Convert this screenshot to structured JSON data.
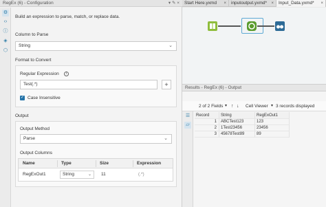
{
  "config": {
    "title": "RegEx (6) - Configuration",
    "title_icons": "▾ ✎ ×",
    "description": "Build an expression to parse, match, or replace data.",
    "column_to_parse": {
      "label": "Column to Parse",
      "value": "String"
    },
    "format_to_convert": {
      "label": "Format to Convert",
      "regex_label": "Regular Expression",
      "regex_value": "Test(.*)",
      "plus_label": "+",
      "case_insensitive_label": "Case Insensitive",
      "case_insensitive_checked": true
    },
    "output": {
      "label": "Output",
      "method_label": "Output Method",
      "method_value": "Parse",
      "columns_label": "Output Columns",
      "columns_headers": [
        "Name",
        "Type",
        "Size",
        "Expression"
      ],
      "columns_rows": [
        {
          "name": "RegExOut1",
          "type": "String",
          "size": "11",
          "expression": "(.*)"
        }
      ]
    }
  },
  "tabs": [
    {
      "label": "Start Here.yxmd"
    },
    {
      "label": "inputoutput.yxmd*"
    },
    {
      "label": "Input_Data.yxmd*"
    }
  ],
  "results": {
    "title": "Results - RegEx (6) - Output",
    "fields_label": "2 of 2 Fields",
    "cell_viewer_label": "Cell Viewer",
    "records_label": "3 records displayed",
    "headers": [
      "Record",
      "String",
      "RegExOut1"
    ],
    "rows": [
      {
        "record": "1",
        "string": "ABCTest123",
        "regex": "123"
      },
      {
        "record": "2",
        "string": "1Test23456",
        "regex": "23456"
      },
      {
        "record": "3",
        "string": "45678Test89",
        "regex": "89"
      }
    ]
  },
  "colors": {
    "accent": "#2574a9",
    "input_node": "#8fbd3c",
    "regex_node": "#5a9b2d",
    "browse_node": "#2d6a96"
  }
}
